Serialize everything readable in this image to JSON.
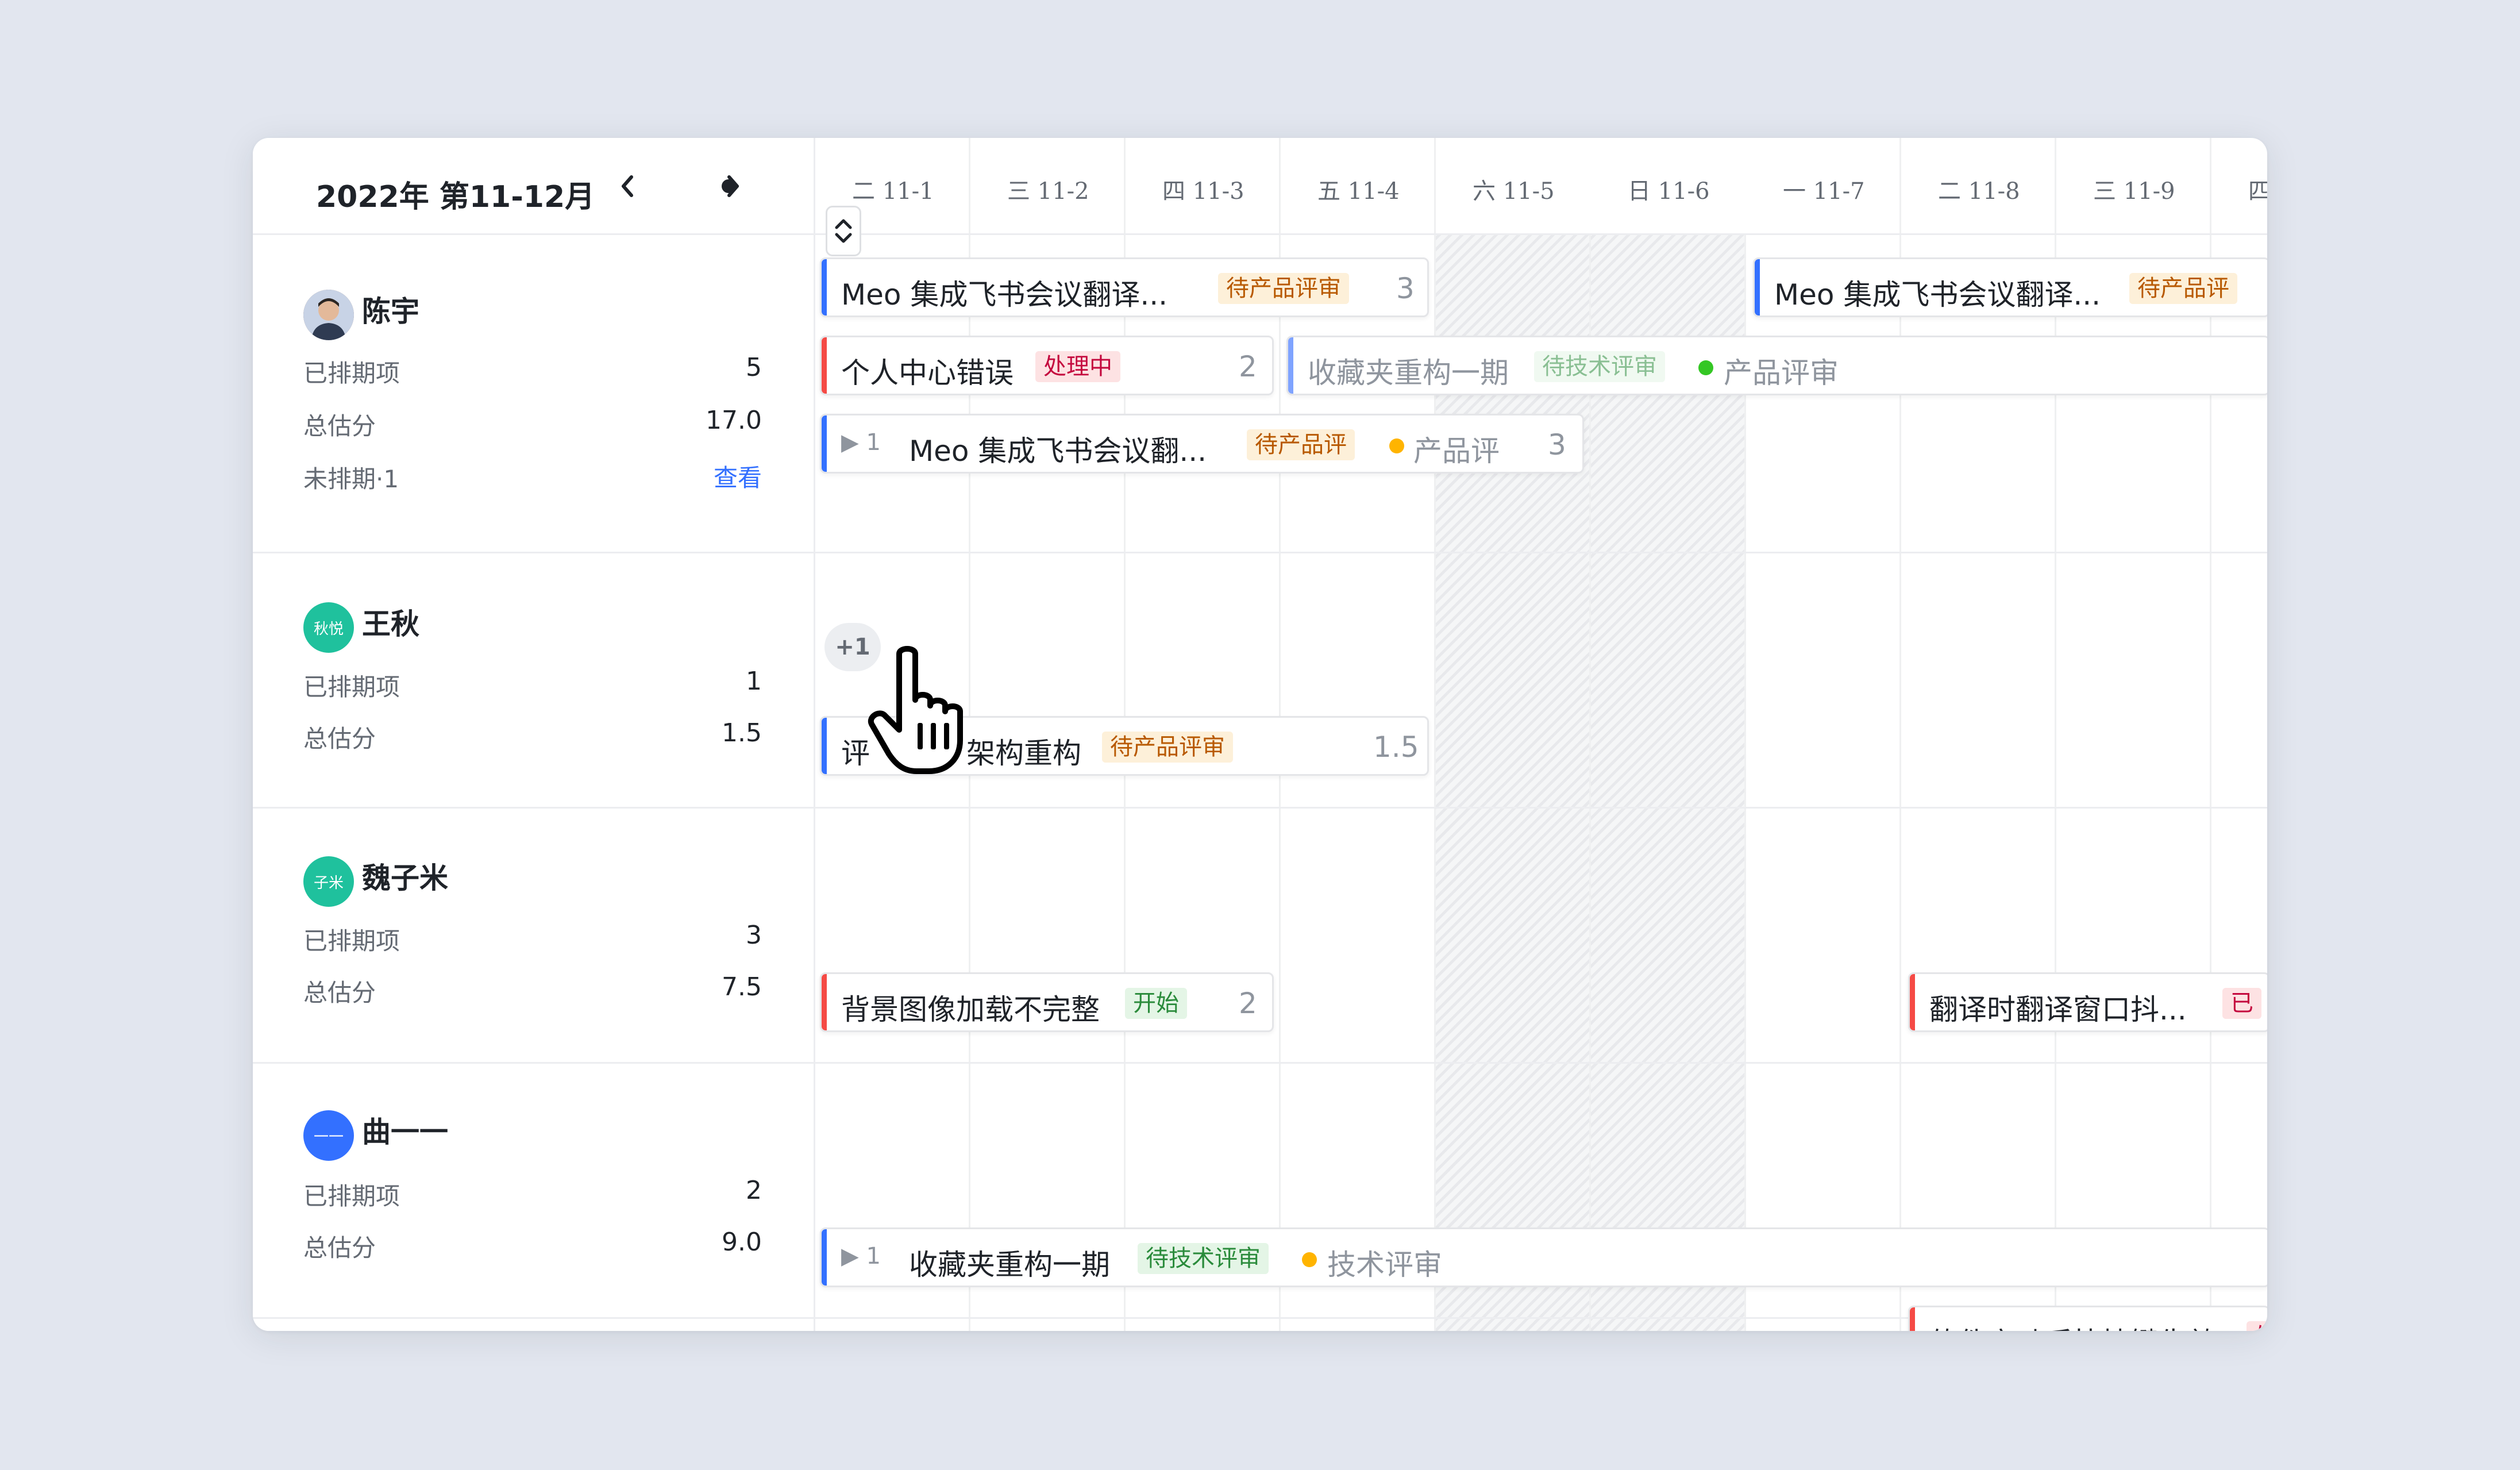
{
  "period": {
    "title": "2022年 第11-12月",
    "prev_icon": "chevron-left-icon",
    "today_icon": "dot-icon",
    "next_icon": "chevron-right-icon"
  },
  "days": [
    {
      "weekday": "二",
      "date": "11-1",
      "weekend": false
    },
    {
      "weekday": "三",
      "date": "11-2",
      "weekend": false
    },
    {
      "weekday": "四",
      "date": "11-3",
      "weekend": false
    },
    {
      "weekday": "五",
      "date": "11-4",
      "weekend": false
    },
    {
      "weekday": "六",
      "date": "11-5",
      "weekend": true
    },
    {
      "weekday": "日",
      "date": "11-6",
      "weekend": true
    },
    {
      "weekday": "一",
      "date": "11-7",
      "weekend": false
    },
    {
      "weekday": "二",
      "date": "11-8",
      "weekend": false
    },
    {
      "weekday": "三",
      "date": "11-9",
      "weekend": false
    },
    {
      "weekday": "四",
      "date": "",
      "weekend": false
    }
  ],
  "people": [
    {
      "name": "陈宇",
      "avatar_text": "",
      "avatar_color": "#8a6b5a",
      "stats": [
        {
          "label": "已排期项",
          "value": "5"
        },
        {
          "label": "总估分",
          "value": "17.0"
        },
        {
          "label": "未排期·1",
          "value": "查看"
        }
      ]
    },
    {
      "name": "王秋",
      "avatar_text": "秋悦",
      "avatar_color": "#1fc19d",
      "stats": [
        {
          "label": "已排期项",
          "value": "1"
        },
        {
          "label": "总估分",
          "value": "1.5"
        }
      ]
    },
    {
      "name": "魏子米",
      "avatar_text": "子米",
      "avatar_color": "#1fc19d",
      "stats": [
        {
          "label": "已排期项",
          "value": "3"
        },
        {
          "label": "总估分",
          "value": "7.5"
        }
      ]
    },
    {
      "name": "曲一一",
      "avatar_text": "一一",
      "avatar_color": "#3370ff",
      "stats": [
        {
          "label": "已排期项",
          "value": "2"
        },
        {
          "label": "总估分",
          "value": "9.0"
        }
      ]
    }
  ],
  "tasks": {
    "t1": {
      "title": "Meo 集成飞书会议翻译...",
      "tag": "待产品评审",
      "points": "3",
      "accent": "#3370ff"
    },
    "t2": {
      "title": "Meo 集成飞书会议翻译...",
      "tag": "待产品评",
      "accent": "#3370ff"
    },
    "t3": {
      "title": "个人中心错误",
      "tag": "处理中",
      "points": "2",
      "accent": "#f54a45"
    },
    "t4": {
      "title": "收藏夹重构一期",
      "tag": "待技术评审",
      "next_step": "产品评审",
      "accent": "#7fa3ff"
    },
    "t5": {
      "expand_icon": "triangle-right-icon",
      "child_count": "1",
      "title": "Meo 集成飞书会议翻...",
      "tag": "待产品评",
      "next_step": "产品评",
      "points": "3",
      "accent": "#3370ff"
    },
    "more": "+1",
    "t6": {
      "title": "评",
      "title_rest": "架构重构",
      "tag": "待产品评审",
      "points": "1.5",
      "accent": "#3370ff"
    },
    "t7": {
      "title": "背景图像加载不完整",
      "tag": "开始",
      "points": "2",
      "accent": "#f54a45"
    },
    "t8": {
      "title": "翻译时翻译窗口抖...",
      "tag": "已",
      "accent": "#f54a45"
    },
    "t9": {
      "expand_icon": "triangle-right-icon",
      "child_count": "1",
      "title": "收藏夹重构一期",
      "tag": "待技术评审",
      "next_step": "技术评审",
      "accent": "#3370ff"
    },
    "t10": {
      "title": "软件启动后快捷键失效",
      "tag": "处",
      "accent": "#f54a45"
    }
  },
  "colors": {
    "accent_blue": "#3370ff",
    "accent_red": "#f54a45",
    "dot_green": "#34c724",
    "dot_orange": "#ffb400"
  }
}
